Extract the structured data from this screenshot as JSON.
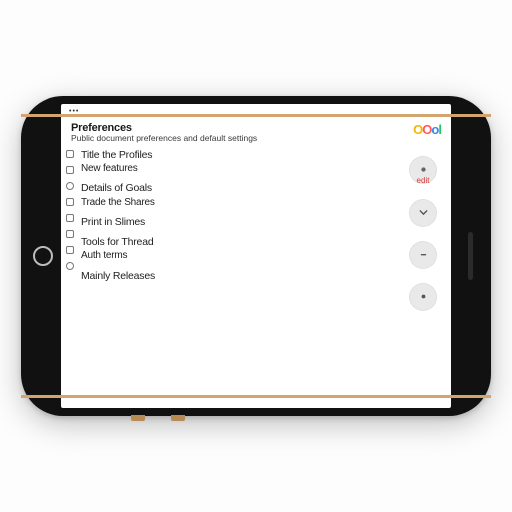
{
  "statusbar": {
    "signal": "•••"
  },
  "header": {
    "title": "Preferences",
    "subtitle": "Public document preferences and default settings"
  },
  "brand": {
    "c1": "O",
    "c2": "O",
    "c3": "o",
    "c4": "l"
  },
  "rail": {
    "items": [
      "box",
      "box",
      "dot",
      "box",
      "box",
      "box",
      "box",
      "dot"
    ]
  },
  "groups": [
    {
      "primary": "Title the Profiles",
      "secondary": "New features"
    },
    {
      "primary": "Details of Goals",
      "secondary": "Trade the Shares"
    },
    {
      "primary": "Print in Slimes",
      "secondary": ""
    },
    {
      "primary": "Tools for Thread",
      "secondary": "Auth terms"
    },
    {
      "primary": "Mainly Releases",
      "secondary": ""
    }
  ],
  "actions": {
    "topLabel": "edit",
    "a1": "dot",
    "a2": "chevron",
    "a3": "dash",
    "a4": "dot"
  }
}
